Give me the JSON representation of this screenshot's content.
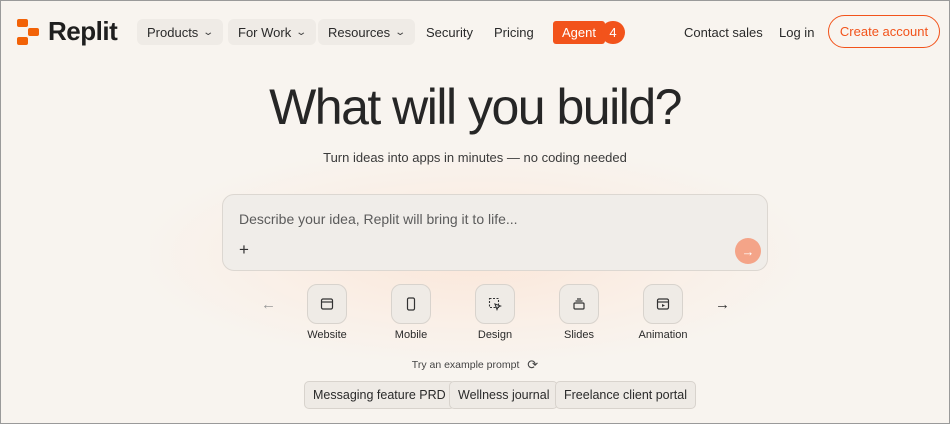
{
  "brand": {
    "name": "Replit",
    "accent": "#f2531b"
  },
  "nav": {
    "products": "Products",
    "for_work": "For Work",
    "resources": "Resources",
    "security": "Security",
    "pricing": "Pricing",
    "agent": "Agent",
    "agent_badge": "4",
    "contact_sales": "Contact sales",
    "log_in": "Log in",
    "create_account": "Create account"
  },
  "hero": {
    "title": "What will you build?",
    "subtitle": "Turn ideas into apps in minutes — no coding needed"
  },
  "prompt": {
    "placeholder": "Describe your idea, Replit will bring it to life...",
    "value": "",
    "plus_icon": "plus-icon",
    "send_icon": "arrow-right-icon"
  },
  "categories": [
    {
      "label": "Website",
      "icon": "browser-window-icon"
    },
    {
      "label": "Mobile",
      "icon": "phone-icon"
    },
    {
      "label": "Design",
      "icon": "design-cursor-icon"
    },
    {
      "label": "Slides",
      "icon": "slides-stack-icon"
    },
    {
      "label": "Animation",
      "icon": "play-window-icon"
    }
  ],
  "example_prompt_label": "Try an example prompt",
  "example_chips": [
    "Messaging feature PRD",
    "Wellness journal",
    "Freelance client portal"
  ]
}
